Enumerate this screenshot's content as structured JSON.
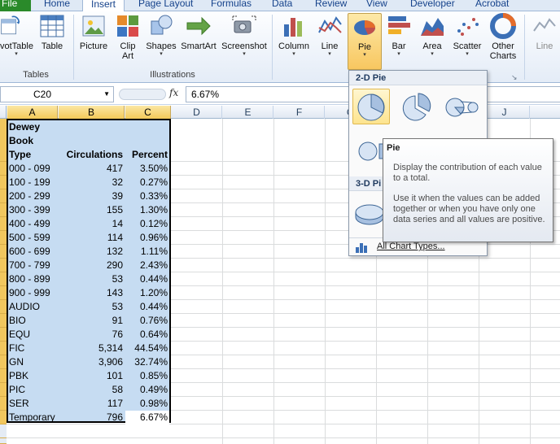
{
  "tabs": [
    {
      "label": "File"
    },
    {
      "label": "Home"
    },
    {
      "label": "Insert"
    },
    {
      "label": "Page Layout"
    },
    {
      "label": "Formulas"
    },
    {
      "label": "Data"
    },
    {
      "label": "Review"
    },
    {
      "label": "View"
    },
    {
      "label": "Developer"
    },
    {
      "label": "Acrobat"
    }
  ],
  "ribbon": {
    "groups": {
      "tables": "Tables",
      "illustrations": "Illustrations"
    },
    "buttons": {
      "pivottable": "votTable",
      "table": "Table",
      "picture": "Picture",
      "clipart": "Clip Art",
      "shapes": "Shapes",
      "smartart": "SmartArt",
      "screenshot": "Screenshot",
      "column": "Column",
      "line": "Line",
      "pie": "Pie",
      "bar": "Bar",
      "area": "Area",
      "scatter": "Scatter",
      "othercharts": "Other Charts",
      "sparkline": "Line"
    },
    "colors": {
      "file_tab": "#2a8a2a",
      "selection_fill": "#c6dcf2",
      "header_highlight": "#f1c75e"
    }
  },
  "formulabar": {
    "namebox": "C20",
    "fx": "fx",
    "value": "6.67%"
  },
  "columns": [
    "A",
    "B",
    "C",
    "D",
    "E",
    "F",
    "G",
    "H",
    "I",
    "J"
  ],
  "table": {
    "header_a": [
      "Dewey",
      "Book",
      "Type"
    ],
    "header_b": "Circulations",
    "header_c": "Percent",
    "rows": [
      {
        "type": "000 - 099",
        "circ": "417",
        "pct": "3.50%"
      },
      {
        "type": "100 - 199",
        "circ": "32",
        "pct": "0.27%"
      },
      {
        "type": "200 - 299",
        "circ": "39",
        "pct": "0.33%"
      },
      {
        "type": "300 - 399",
        "circ": "155",
        "pct": "1.30%"
      },
      {
        "type": "400 - 499",
        "circ": "14",
        "pct": "0.12%"
      },
      {
        "type": "500 - 599",
        "circ": "114",
        "pct": "0.96%"
      },
      {
        "type": "600 - 699",
        "circ": "132",
        "pct": "1.11%"
      },
      {
        "type": "700 - 799",
        "circ": "290",
        "pct": "2.43%"
      },
      {
        "type": "800 - 899",
        "circ": "53",
        "pct": "0.44%"
      },
      {
        "type": "900 - 999",
        "circ": "143",
        "pct": "1.20%"
      },
      {
        "type": "AUDIO",
        "circ": "53",
        "pct": "0.44%"
      },
      {
        "type": "BIO",
        "circ": "91",
        "pct": "0.76%"
      },
      {
        "type": "EQU",
        "circ": "76",
        "pct": "0.64%"
      },
      {
        "type": "FIC",
        "circ": "5,314",
        "pct": "44.54%"
      },
      {
        "type": "GN",
        "circ": "3,906",
        "pct": "32.74%"
      },
      {
        "type": "PBK",
        "circ": "101",
        "pct": "0.85%"
      },
      {
        "type": "PIC",
        "circ": "58",
        "pct": "0.49%"
      },
      {
        "type": "SER",
        "circ": "117",
        "pct": "0.98%"
      },
      {
        "type": "Temporary",
        "circ": "796",
        "pct": "6.67%"
      }
    ]
  },
  "gallery": {
    "section_2d": "2-D Pie",
    "section_3d": "3-D Pi",
    "all_chart_types": "All Chart Types..."
  },
  "tooltip": {
    "title": "Pie",
    "p1": "Display the contribution of each value to a total.",
    "p2": "Use it when the values can be added together or when you have only one data series and all values are positive."
  }
}
